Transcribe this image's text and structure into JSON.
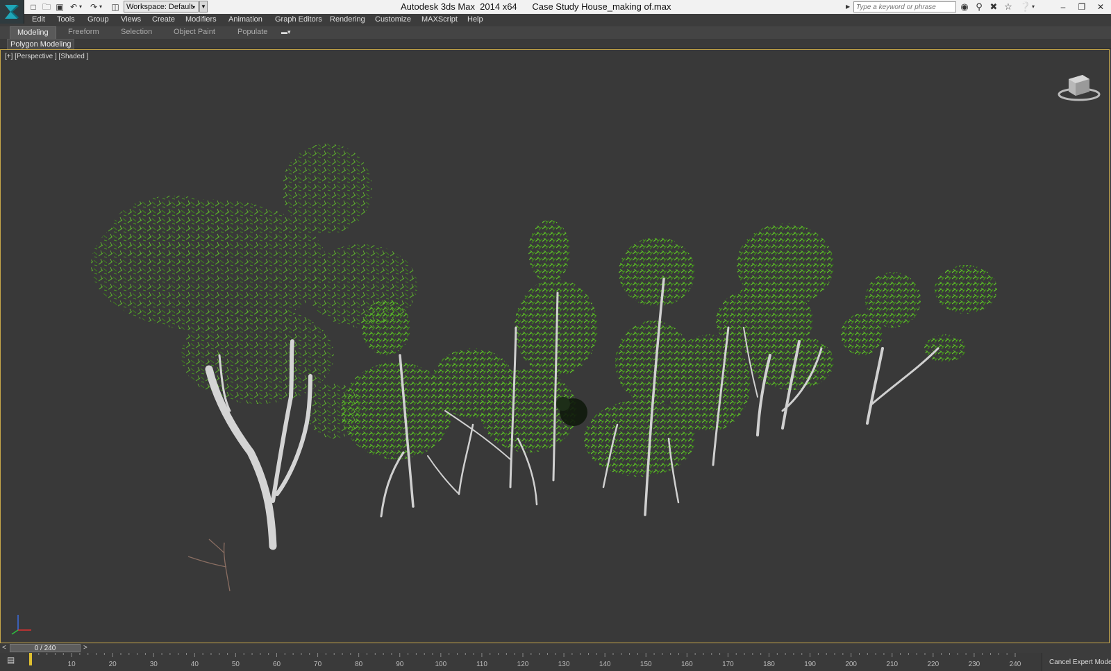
{
  "titlebar": {
    "workspace": "Workspace: Default",
    "app_title": "Autodesk 3ds Max  2014 x64      Case Study House_making of.max",
    "search_placeholder": "Type a keyword or phrase",
    "quick_access_icons": [
      "new-file-icon",
      "open-file-icon",
      "save-icon",
      "undo-icon",
      "redo-icon",
      "project-folder-icon"
    ],
    "info_icons": [
      "binoculars-icon",
      "key-icon",
      "exchange-icon",
      "favorites-star-icon",
      "help-icon"
    ],
    "window_controls": [
      "minimize",
      "restore",
      "close"
    ]
  },
  "menu": [
    "Edit",
    "Tools",
    "Group",
    "Views",
    "Create",
    "Modifiers",
    "Animation",
    "Graph Editors",
    "Rendering",
    "Customize",
    "MAXScript",
    "Help"
  ],
  "ribbon": {
    "tabs": [
      "Modeling",
      "Freeform",
      "Selection",
      "Object Paint",
      "Populate"
    ],
    "active_tab": "Modeling",
    "panel_label": "Polygon Modeling"
  },
  "viewport": {
    "label": "[+] [Perspective ] [Shaded ]",
    "border_color": "#c8a84a",
    "background": "#393939",
    "foliage_color": "#4fa81c",
    "trunk_color": "#d4d4d4"
  },
  "timeslider": {
    "position": "0 / 240",
    "frame": 0,
    "total": 240,
    "prev": "<",
    "next": ">"
  },
  "trackbar": {
    "ticks": [
      10,
      20,
      30,
      40,
      50,
      60,
      70,
      80,
      90,
      100,
      110,
      120,
      130,
      140,
      150,
      160,
      170,
      180,
      190,
      200,
      210,
      220,
      230,
      240
    ]
  },
  "status": {
    "cancel_expert": "Cancel Expert Mode"
  }
}
